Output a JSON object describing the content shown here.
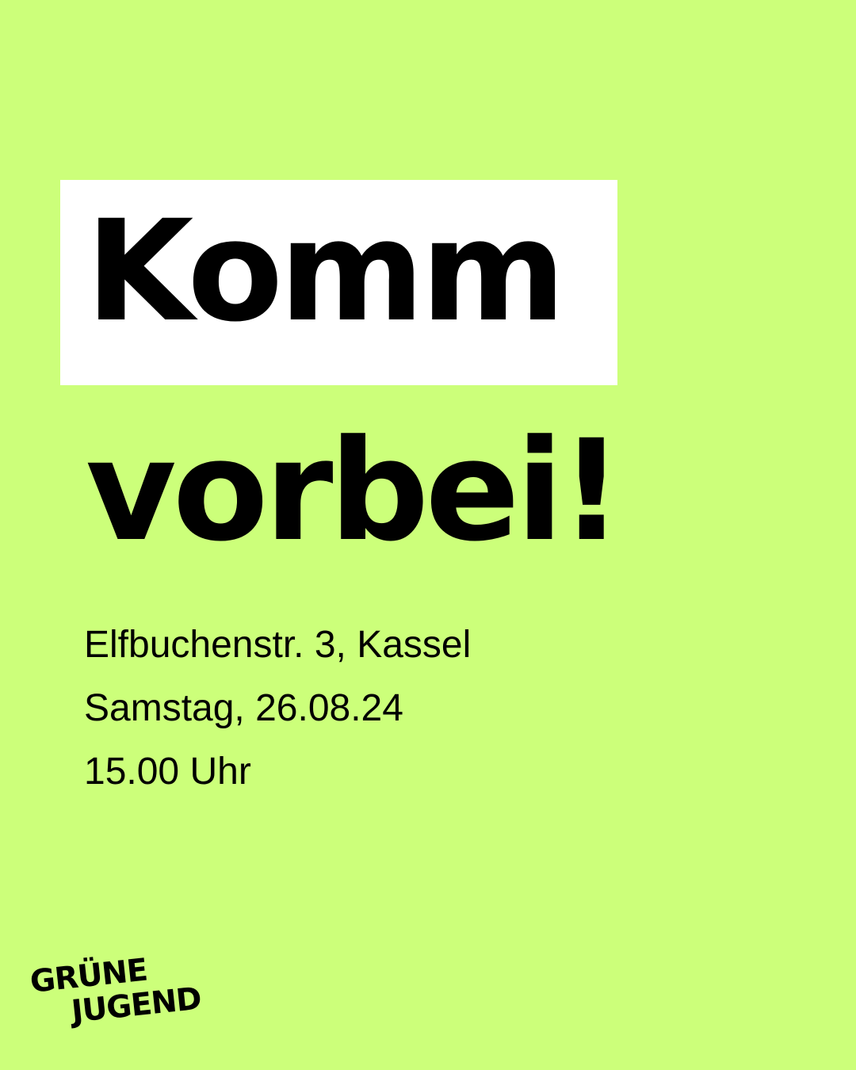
{
  "headline": {
    "line1": "Komm",
    "line2": "vorbei!"
  },
  "details": {
    "address": "Elfbuchenstr. 3, Kassel",
    "date": "Samstag, 26.08.24",
    "time": "15.00 Uhr"
  },
  "logo": {
    "line1": "GRÜNE",
    "line2": "JUGEND"
  },
  "colors": {
    "background": "#ccff7a",
    "highlight_box": "#ffffff",
    "text": "#000000"
  }
}
